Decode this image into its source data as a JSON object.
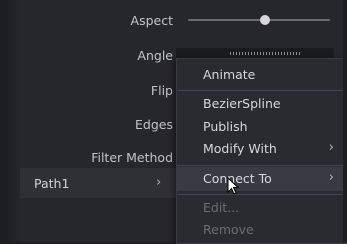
{
  "inspector": {
    "fields": {
      "aspect": "Aspect",
      "angle": "Angle",
      "flip": "Flip",
      "edges": "Edges",
      "filter_method": "Filter Method"
    },
    "aspect_slider_value": 0.5,
    "path_row": {
      "label": "Path1",
      "chevron": "›"
    }
  },
  "context_menu": {
    "items": [
      {
        "label": "Animate",
        "enabled": true
      },
      {
        "label": "BezierSpline",
        "enabled": true
      },
      {
        "label": "Publish",
        "enabled": true
      },
      {
        "label": "Modify With",
        "enabled": true,
        "submenu": true
      },
      {
        "label": "Connect To",
        "enabled": true,
        "submenu": true,
        "hovered": true
      },
      {
        "label": "Edit...",
        "enabled": false
      },
      {
        "label": "Remove",
        "enabled": false
      }
    ],
    "submenu_chevron": "›"
  },
  "colors": {
    "panel_bg": "#26272c",
    "menu_bg": "#2a2b31",
    "menu_hover": "#3a3b42",
    "disabled_text": "#6b6c72"
  },
  "icons": {
    "cursor": "arrow-cursor-icon"
  }
}
